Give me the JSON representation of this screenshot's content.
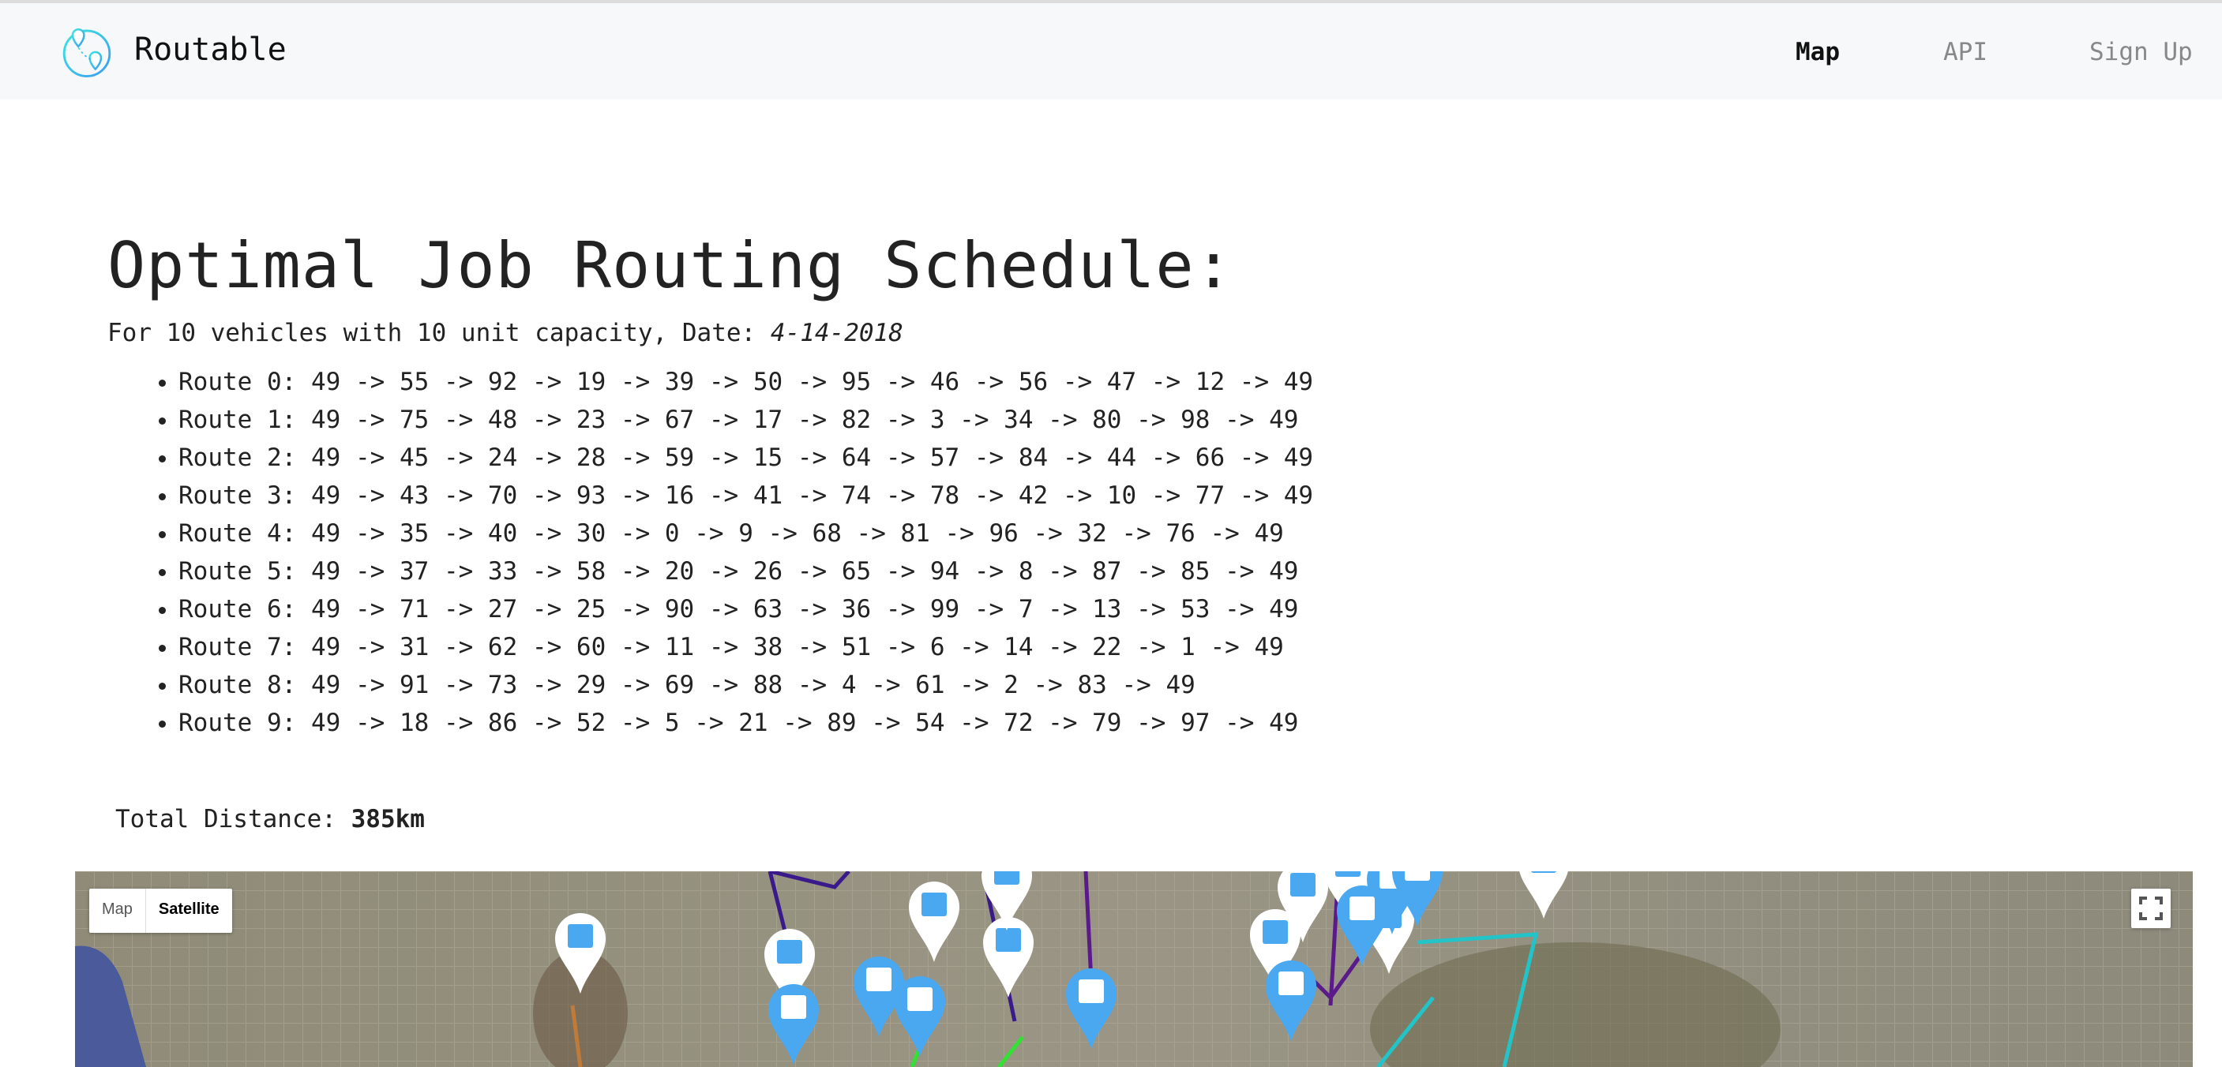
{
  "header": {
    "brand": "Routable",
    "nav": [
      {
        "label": "Map",
        "active": true
      },
      {
        "label": "API"
      },
      {
        "label": "Sign Up"
      }
    ]
  },
  "main": {
    "title": "Optimal Job Routing Schedule:",
    "subtitle_prefix": "For 10 vehicles with 10 unit capacity, Date: ",
    "date": "4-14-2018",
    "routes": [
      "Route 0: 49 -> 55 -> 92 -> 19 -> 39 -> 50 -> 95 -> 46 -> 56 -> 47 -> 12 -> 49",
      "Route 1: 49 -> 75 -> 48 -> 23 -> 67 -> 17 -> 82 -> 3 -> 34 -> 80 -> 98 -> 49",
      "Route 2: 49 -> 45 -> 24 -> 28 -> 59 -> 15 -> 64 -> 57 -> 84 -> 44 -> 66 -> 49",
      "Route 3: 49 -> 43 -> 70 -> 93 -> 16 -> 41 -> 74 -> 78 -> 42 -> 10 -> 77 -> 49",
      "Route 4: 49 -> 35 -> 40 -> 30 -> 0 -> 9 -> 68 -> 81 -> 96 -> 32 -> 76 -> 49",
      "Route 5: 49 -> 37 -> 33 -> 58 -> 20 -> 26 -> 65 -> 94 -> 8 -> 87 -> 85 -> 49",
      "Route 6: 49 -> 71 -> 27 -> 25 -> 90 -> 63 -> 36 -> 99 -> 7 -> 13 -> 53 -> 49",
      "Route 7: 49 -> 31 -> 62 -> 60 -> 11 -> 38 -> 51 -> 6 -> 14 -> 22 -> 1 -> 49",
      "Route 8: 49 -> 91 -> 73 -> 29 -> 69 -> 88 -> 4 -> 61 -> 2 -> 83 -> 49",
      "Route 9: 49 -> 18 -> 86 -> 52 -> 5 -> 21 -> 89 -> 54 -> 72 -> 79 -> 97 -> 49"
    ],
    "total_label": "Total Distance: ",
    "total_value": "385km"
  },
  "map": {
    "type_map": "Map",
    "type_satellite": "Satellite",
    "selected": "Satellite",
    "route_colors": [
      "#3a1a8a",
      "#5a1a8a",
      "#33e033",
      "#22c4c8",
      "#c07a3a"
    ],
    "marker_color": "#4aa8f0"
  }
}
